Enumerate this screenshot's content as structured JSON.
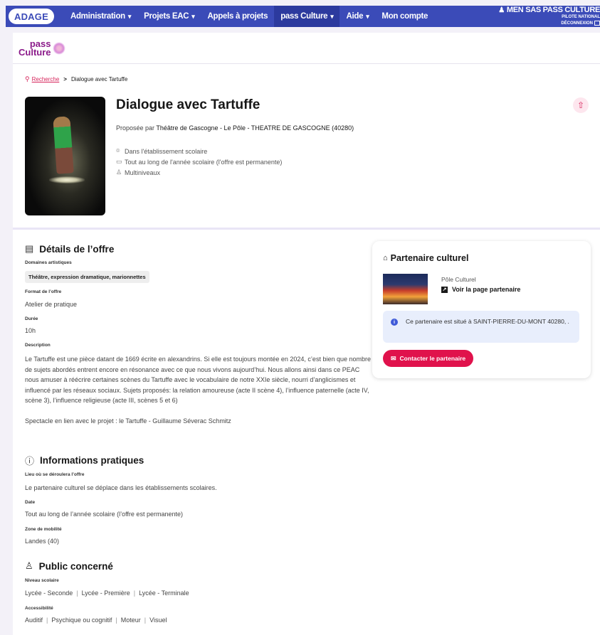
{
  "topnav": {
    "logo": "ADAGE",
    "items": [
      {
        "label": "Administration",
        "caret": "▾"
      },
      {
        "label": "Projets EAC",
        "caret": "▾"
      },
      {
        "label": "Appels à projets",
        "caret": ""
      },
      {
        "label": "pass Culture",
        "caret": "▾"
      },
      {
        "label": "Aide",
        "caret": "▾"
      },
      {
        "label": "Mon compte",
        "caret": ""
      }
    ],
    "user_name": "MEN SAS PASS CULTURE",
    "user_role": "PILOTE NATIONAL",
    "logout": "DÉCONNEXION"
  },
  "brand": {
    "line1": "pass",
    "line2": "Culture"
  },
  "breadcrumb": {
    "link": "Recherche",
    "separator": ">",
    "current": "Dialogue avec Tartuffe"
  },
  "offer": {
    "title": "Dialogue avec Tartuffe",
    "proposed_prefix": "Proposée par",
    "proposed_by": "Théâtre de Gascogne - Le Pôle - THEATRE DE GASCOGNE (40280)",
    "location": "Dans l'établissement scolaire",
    "period": "Tout au long de l'année scolaire (l'offre est permanente)",
    "level": "Multiniveaux"
  },
  "details": {
    "title": "Détails de l’offre",
    "domains_label": "Domaines artistiques",
    "domains_tag": "Théâtre, expression dramatique, marionnettes",
    "format_label": "Format de l’offre",
    "format_value": "Atelier de pratique",
    "duration_label": "Durée",
    "duration_value": "10h",
    "description_label": "Description",
    "description_p1": "Le Tartuffe est une pièce datant de 1669 écrite en alexandrins. Si elle est toujours montée en 2024, c’est bien que nombre de sujets abordés entrent encore en résonance avec ce que nous vivons aujourd’hui. Nous allons ainsi dans ce PEAC nous amuser à réécrire certaines scènes du Tartuffe avec le vocabulaire de notre XXIe siècle, nourri d’anglicismes et influencé par les réseaux sociaux. Sujets proposés: la relation amoureuse (acte II scène 4), l’influence paternelle (acte IV, scène 3), l’influence religieuse (acte III, scènes 5 et 6)",
    "description_p2": "Spectacle en lien avec le projet : le Tartuffe - Guillaume Séverac Schmitz"
  },
  "practical": {
    "title": "Informations pratiques",
    "place_label": "Lieu où se déroulera l’offre",
    "place_value": "Le partenaire culturel se déplace dans les établissements scolaires.",
    "date_label": "Date",
    "date_value": "Tout au long de l’année scolaire (l’offre est permanente)",
    "zone_label": "Zone de mobilité",
    "zone_value": "Landes (40)"
  },
  "audience": {
    "title": "Public concerné",
    "level_label": "Niveau scolaire",
    "levels": [
      "Lycée - Seconde",
      "Lycée - Première",
      "Lycée - Terminale"
    ],
    "access_label": "Accessibilité",
    "access": [
      "Auditif",
      "Psychique ou cognitif",
      "Moteur",
      "Visuel"
    ]
  },
  "partner": {
    "title": "Partenaire culturel",
    "type": "Pôle Culturel",
    "link": "Voir la page partenaire",
    "info": "Ce partenaire est situé à SAINT-PIERRE-DU-MONT 40280, .",
    "info_prefix": "Ce partenaire est situé à ",
    "info_place": "SAINT-PIERRE-DU-MONT 40280, .",
    "contact": "Contacter le partenaire"
  },
  "colors": {
    "nav": "#3b4bb8",
    "accent": "#e0124c",
    "brand": "#8b1a8a",
    "info_bg": "#e8eefc"
  },
  "icons": [
    "search-icon",
    "share-icon",
    "map-pin-icon",
    "calendar-icon",
    "user-icon",
    "document-icon",
    "info-circle-icon",
    "bank-icon",
    "external-link-icon",
    "mail-icon"
  ]
}
